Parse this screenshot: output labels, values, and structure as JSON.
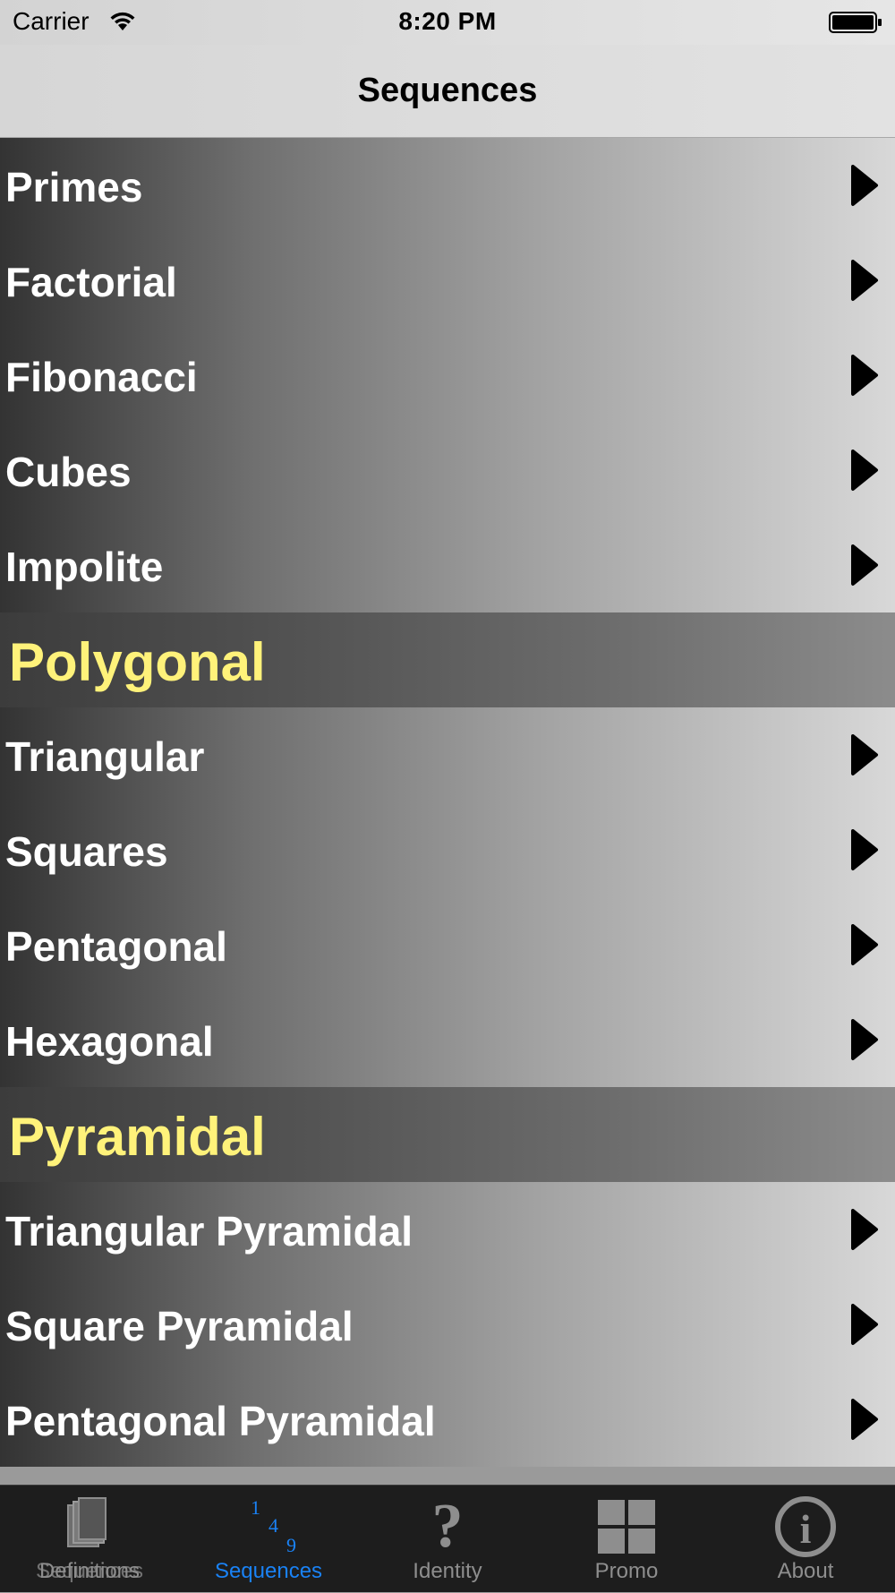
{
  "status_bar": {
    "carrier": "Carrier",
    "time": "8:20 PM"
  },
  "nav": {
    "title": "Sequences"
  },
  "list": {
    "group1": [
      "Primes",
      "Factorial",
      "Fibonacci",
      "Cubes",
      "Impolite"
    ],
    "section2": "Polygonal",
    "group2": [
      "Triangular",
      "Squares",
      "Pentagonal",
      "Hexagonal"
    ],
    "section3": "Pyramidal",
    "group3": [
      "Triangular Pyramidal",
      "Square Pyramidal",
      "Pentagonal Pyramidal"
    ]
  },
  "tabs": {
    "tab1_label_a": "Definitions",
    "tab1_label_b": "Sequences",
    "tab2_label": "Sequences",
    "tab2_icon_digits": [
      "1",
      "4",
      "9"
    ],
    "tab3_label": "Identity",
    "tab4_label": "Promo",
    "tab5_label": "About",
    "active_tab": "Sequences"
  },
  "colors": {
    "section_text": "#fff27a",
    "active_tab": "#1a82f5",
    "inactive_tab": "#8e8e8e"
  }
}
